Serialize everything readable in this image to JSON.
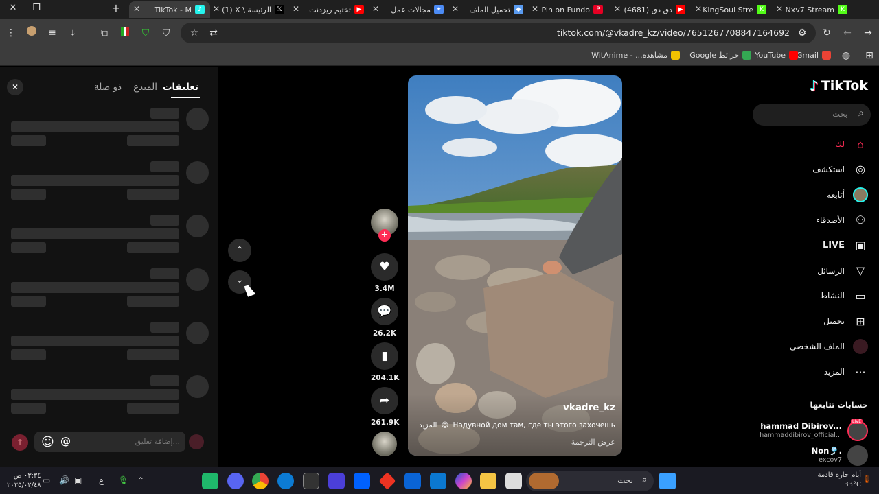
{
  "browser": {
    "window_controls": {
      "close": "✕",
      "restore": "❐",
      "minimize": "—"
    },
    "new_tab": "+",
    "tabs": [
      {
        "title": "TikTok - M",
        "fav": "#25F4EE",
        "icon": "♪",
        "active": true
      },
      {
        "title": "(1) X \\ الرئيسة",
        "fav": "#000000",
        "icon": "𝕏"
      },
      {
        "title": "تختيم ريزدنت",
        "fav": "#ff0000",
        "icon": "▶"
      },
      {
        "title": "مجالات عمل",
        "fav": "#4c8bf5",
        "icon": "✦"
      },
      {
        "title": "تحميل الملف",
        "fav": "#5a9bf0",
        "icon": "◆"
      },
      {
        "title": "Pin on Fundo",
        "fav": "#e60023",
        "icon": "P"
      },
      {
        "title": "(4681) دق دق",
        "fav": "#ff0000",
        "icon": "▶"
      },
      {
        "title": "KingSoul Stre",
        "fav": "#53fc18",
        "icon": "K"
      },
      {
        "title": "Nxv7 Stream",
        "fav": "#53fc18",
        "icon": "K"
      }
    ],
    "url": "tiktok.com/@vkadre_kz/video/7651267708847164692",
    "bookmarks": [
      {
        "label": "Gmail",
        "color": "#ea4335"
      },
      {
        "label": "YouTube",
        "color": "#ff0000"
      },
      {
        "label": "خرائط Google",
        "color": "#34a853"
      },
      {
        "label": "مشاهدة... - WitAnime",
        "color": "#f2c100"
      }
    ]
  },
  "comments_panel": {
    "tabs": [
      "تعليقات",
      "المبدع",
      "ذو صلة"
    ],
    "close_icon": "✕",
    "input_placeholder": "إضافة تعليق...",
    "at_icon": "@",
    "emoji_icon": "☺",
    "send_icon": "↑"
  },
  "video": {
    "username": "vkadre_kz",
    "caption": "Надувной дом там, где ты этого захочешь",
    "caption_emoji": "😍",
    "more_label": "المزيد",
    "translate_label": "عرض الترجمة",
    "likes": "3.4M",
    "comments": "26.2K",
    "saves": "204.1K",
    "shares": "261.9K",
    "follow_icon": "+",
    "nav_up": "⌃",
    "nav_down": "⌄"
  },
  "sidebar": {
    "logo": "TikTok",
    "search_placeholder": "بحث",
    "nav": [
      {
        "label": "لك",
        "icon": "home-icon",
        "glyph": "⌂",
        "active": true
      },
      {
        "label": "استكشف",
        "icon": "compass-icon",
        "glyph": "◎"
      },
      {
        "label": "أتابعه",
        "icon": "avatar-icon",
        "glyph": "●"
      },
      {
        "label": "الأصدقاء",
        "icon": "friends-icon",
        "glyph": "⚇"
      },
      {
        "label": "LIVE",
        "icon": "live-icon",
        "glyph": "▣"
      },
      {
        "label": "الرسائل",
        "icon": "messages-icon",
        "glyph": "▽"
      },
      {
        "label": "النشاط",
        "icon": "activity-icon",
        "glyph": "▭"
      },
      {
        "label": "تحميل",
        "icon": "upload-icon",
        "glyph": "⊞"
      },
      {
        "label": "الملف الشخصي",
        "icon": "profile-icon",
        "glyph": "●"
      },
      {
        "label": "المزيد",
        "icon": "more-icon",
        "glyph": "···"
      }
    ],
    "following_title": "حسابات تتابعها",
    "following": [
      {
        "name": "hammad Dibirov...",
        "handle": "hammaddibirov_official...",
        "badge": "LIVE"
      },
      {
        "name": "Non🎐.",
        "handle": "excov7",
        "badge": ""
      }
    ]
  },
  "taskbar": {
    "search_placeholder": "بحث",
    "weather_text": "أيام حارة قادمة",
    "temperature": "33°C",
    "time": "٠٣:٣٤ ص",
    "date": "٢٠٢٥/٠٢/٤٨",
    "lang": "ع"
  }
}
